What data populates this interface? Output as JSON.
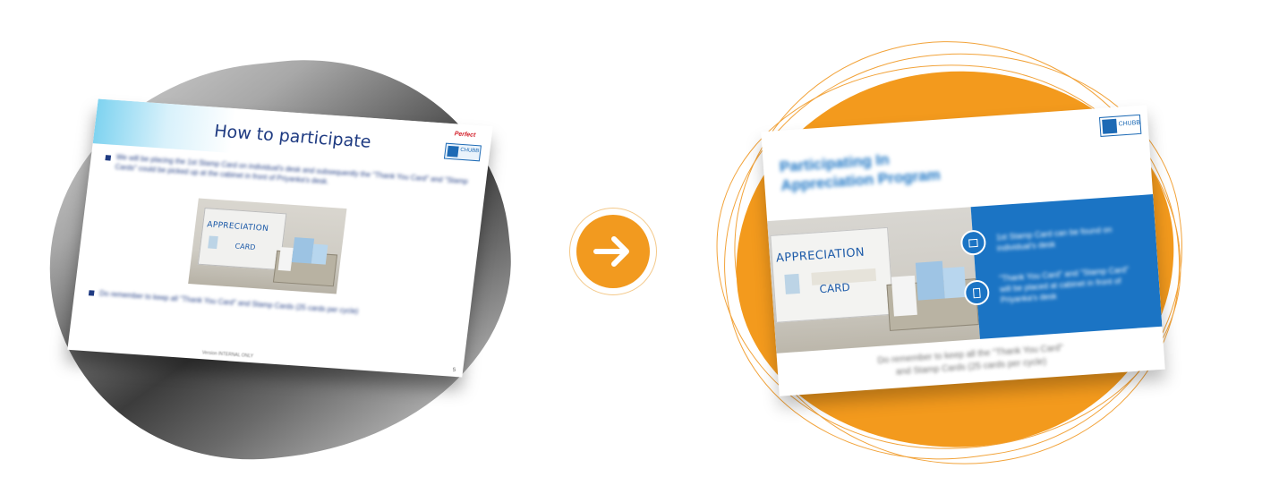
{
  "left_slide": {
    "title": "How to participate",
    "brand": "Perfect",
    "logo_text": "CHUBB",
    "bullet_1": "We will be placing the 1st Stamp Card on individual's desk and subsequently the \"Thank You Card\" and \"Stamp Cards\" could be picked up at the cabinet in front of Priyanka's desk.",
    "bullet_2": "Do remember to keep all \"Thank You Card\" and Stamp Cards (25 cards per cycle)",
    "photo_text_1": "APPRECIATION",
    "photo_text_2": "CARD",
    "footer": "Version INTERNAL ONLY",
    "page_number": "5"
  },
  "arrow": {
    "icon": "arrow-right-icon"
  },
  "right_slide": {
    "title_line_1": "Participating In",
    "title_line_2": "Appreciation Program",
    "logo_text": "CHUBB",
    "photo_text_1": "APPRECIATION",
    "photo_text_2": "CARD",
    "panel_item_1": "1st Stamp Card can be found on individual's desk",
    "panel_item_2": "\"Thank You Card\" and \"Stamp Card\" will be placed at cabinet in front of Priyanka's desk",
    "bottom_line_1": "Do remember to keep all the \"Thank You Card\"",
    "bottom_line_2": "and Stamp Cards (25 cards per cycle)"
  },
  "colors": {
    "orange": "#f39a1d",
    "blue": "#1b74c4",
    "navy": "#1f3b82"
  }
}
